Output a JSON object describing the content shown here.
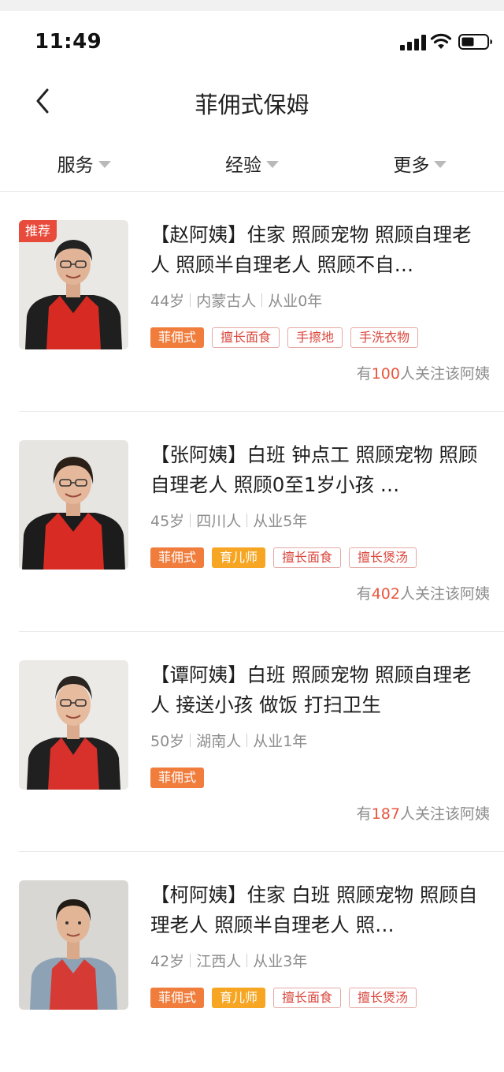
{
  "status_bar": {
    "time": "11:49"
  },
  "nav": {
    "title": "菲佣式保姆"
  },
  "filters": [
    {
      "label": "服务"
    },
    {
      "label": "经验"
    },
    {
      "label": "更多"
    }
  ],
  "colors": {
    "accent": "#e8553e",
    "tag_orange": "#f07d3c",
    "tag_yellow": "#f6a623",
    "badge_red": "#e84b3b"
  },
  "cards": [
    {
      "badge": "推荐",
      "title": "【赵阿姨】住家 照顾宠物 照顾自理老人 照顾半自理老人 照顾不自…",
      "age": "44岁",
      "hometown": "内蒙古人",
      "experience": "从业0年",
      "tags": [
        {
          "label": "菲佣式",
          "style": "orange"
        },
        {
          "label": "擅长面食",
          "style": "outline"
        },
        {
          "label": "手擦地",
          "style": "outline"
        },
        {
          "label": "手洗衣物",
          "style": "outline"
        }
      ],
      "follow_prefix": "有",
      "follow_count": "100",
      "follow_suffix": "人关注该阿姨"
    },
    {
      "title": "【张阿姨】白班 钟点工 照顾宠物 照顾自理老人 照顾0至1岁小孩 …",
      "age": "45岁",
      "hometown": "四川人",
      "experience": "从业5年",
      "tags": [
        {
          "label": "菲佣式",
          "style": "orange"
        },
        {
          "label": "育儿师",
          "style": "yellow"
        },
        {
          "label": "擅长面食",
          "style": "outline"
        },
        {
          "label": "擅长煲汤",
          "style": "outline"
        }
      ],
      "follow_prefix": "有",
      "follow_count": "402",
      "follow_suffix": "人关注该阿姨"
    },
    {
      "title": "【谭阿姨】白班 照顾宠物 照顾自理老人 接送小孩 做饭 打扫卫生",
      "age": "50岁",
      "hometown": "湖南人",
      "experience": "从业1年",
      "tags": [
        {
          "label": "菲佣式",
          "style": "orange"
        }
      ],
      "follow_prefix": "有",
      "follow_count": "187",
      "follow_suffix": "人关注该阿姨"
    },
    {
      "title": "【柯阿姨】住家 白班 照顾宠物 照顾自理老人 照顾半自理老人 照…",
      "age": "42岁",
      "hometown": "江西人",
      "experience": "从业3年",
      "tags": [
        {
          "label": "菲佣式",
          "style": "orange"
        },
        {
          "label": "育儿师",
          "style": "yellow"
        },
        {
          "label": "擅长面食",
          "style": "outline"
        },
        {
          "label": "擅长煲汤",
          "style": "outline"
        }
      ],
      "follow_prefix": "",
      "follow_count": "",
      "follow_suffix": ""
    }
  ]
}
